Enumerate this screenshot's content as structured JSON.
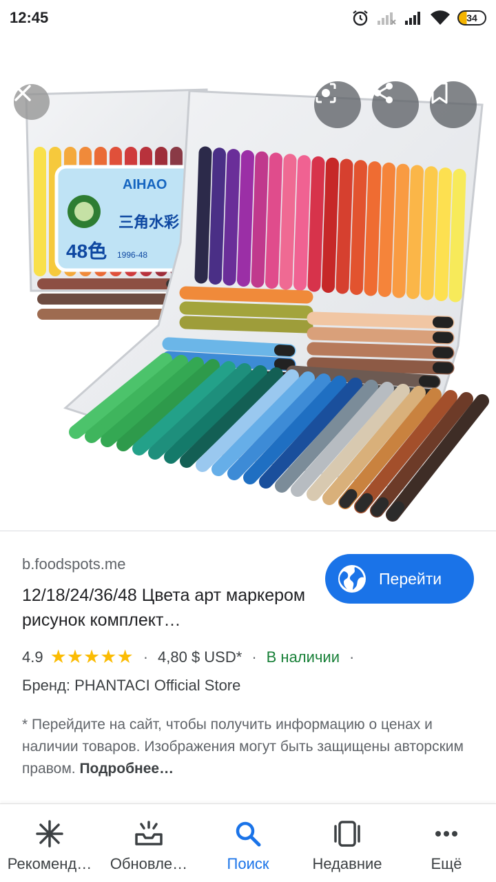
{
  "status_bar": {
    "time": "12:45",
    "battery": "34",
    "icons": [
      "alarm-icon",
      "signal-icon",
      "signal-icon",
      "wifi-icon",
      "battery-icon"
    ]
  },
  "image_overlay": {
    "buttons": [
      "close-icon",
      "lens-icon",
      "share-icon",
      "bookmark-icon"
    ],
    "package_brand": "AIHAO",
    "package_count": "48色",
    "package_code": "1996-48",
    "package_chinese": "三角水彩"
  },
  "result": {
    "domain": "b.foodspots.me",
    "title": "12/18/24/36/48 Цвета арт маркером рисунок комплект…",
    "go_button": "Перейти",
    "rating": "4.9",
    "stars": 5,
    "price": "4,80 $ USD*",
    "availability": "В наличии",
    "separator": "·",
    "brand": "Бренд: PHANTACI Official Store",
    "disclaimer": "* Перейдите на сайт, чтобы получить информацию о ценах и наличии товаров. Изображения могут быть защищены авторским правом.",
    "more_link": "Подробнее…"
  },
  "bottom_nav": {
    "items": [
      {
        "label": "Рекоменд…",
        "icon": "asterisk-icon"
      },
      {
        "label": "Обновле…",
        "icon": "updates-icon"
      },
      {
        "label": "Поиск",
        "icon": "search-icon",
        "active": true
      },
      {
        "label": "Недавние",
        "icon": "recent-icon"
      },
      {
        "label": "Ещё",
        "icon": "more-icon"
      }
    ]
  },
  "colors": {
    "accent": "#1a73e8",
    "star": "#fbbc04",
    "in_stock": "#188038"
  }
}
